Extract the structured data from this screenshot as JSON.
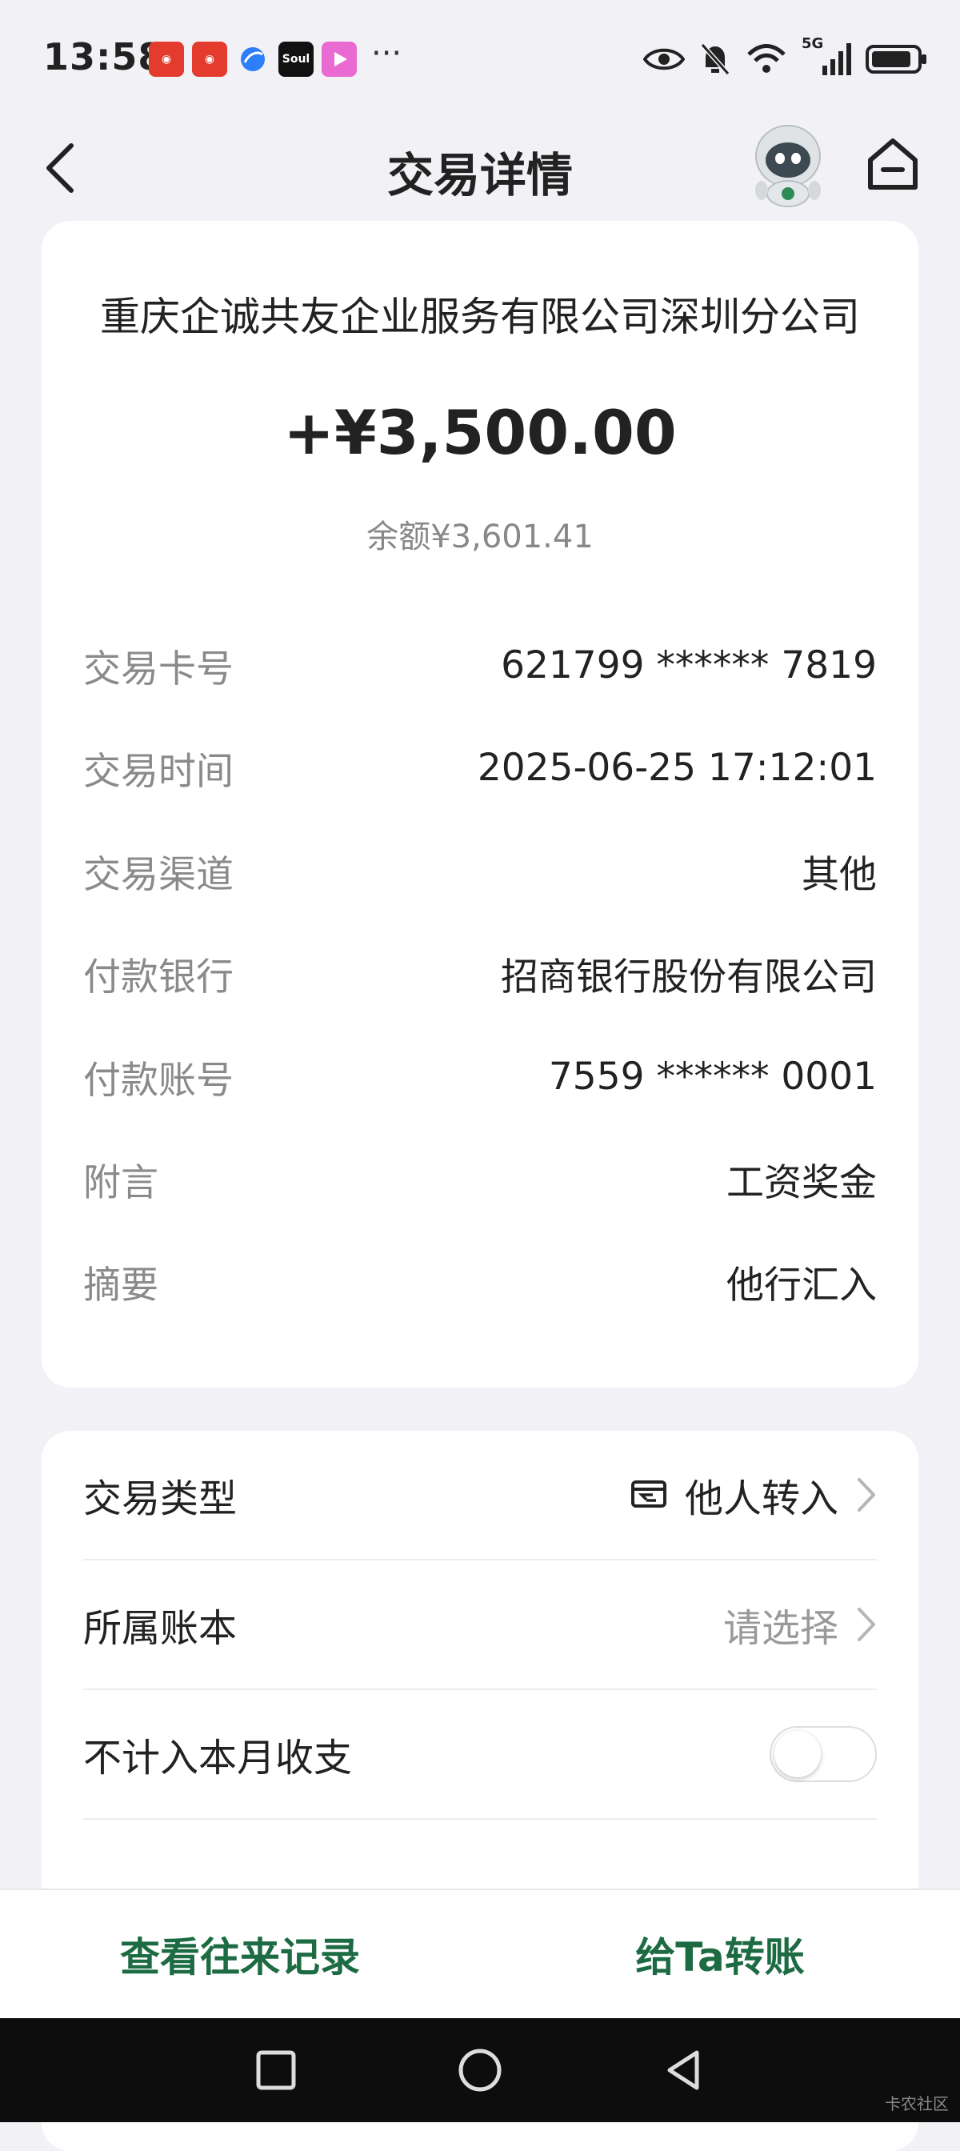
{
  "status_bar": {
    "time": "13:58",
    "app_icons": [
      "weibo-icon",
      "weibo-icon",
      "browser-icon",
      "soul-icon",
      "video-icon"
    ],
    "more": "···",
    "network": "5G"
  },
  "header": {
    "title": "交易详情"
  },
  "transaction": {
    "payer": "重庆企诚共友企业服务有限公司深圳分公司",
    "amount": "+¥3,500.00",
    "balance": "余额¥3,601.41",
    "details": [
      {
        "label": "交易卡号",
        "value": "621799 ****** 7819"
      },
      {
        "label": "交易时间",
        "value": "2025-06-25 17:12:01"
      },
      {
        "label": "交易渠道",
        "value": "其他"
      },
      {
        "label": "付款银行",
        "value": "招商银行股份有限公司"
      },
      {
        "label": "付款账号",
        "value": "7559 ****** 0001"
      },
      {
        "label": "附言",
        "value": "工资奖金"
      },
      {
        "label": "摘要",
        "value": "他行汇入"
      }
    ]
  },
  "settings": {
    "type_label": "交易类型",
    "type_value": "他人转入",
    "book_label": "所属账本",
    "book_value": "请选择",
    "exclude_label": "不计入本月收支",
    "exclude_on": false
  },
  "actions": {
    "history": "查看往来记录",
    "transfer": "给Ta转账"
  },
  "watermark": "卡农社区",
  "colors": {
    "accent": "#1d6b43",
    "background": "#f2f2f6",
    "card": "#ffffff"
  }
}
